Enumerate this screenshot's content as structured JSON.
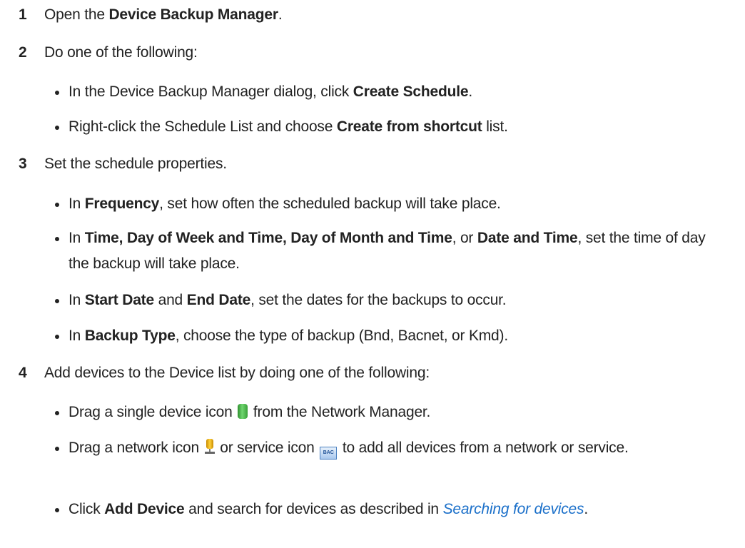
{
  "steps": [
    {
      "num": "1",
      "pre": "Open the ",
      "bold": "Device Backup Manager",
      "post": "."
    },
    {
      "num": "2",
      "text": "Do one of the following:",
      "bullets": [
        {
          "pre": "In the Device Backup Manager dialog, click ",
          "bold": "Create Schedule",
          "post": "."
        },
        {
          "pre": "Right-click the Schedule List and choose ",
          "bold": "Create from shortcut",
          "post": " list."
        }
      ]
    },
    {
      "num": "3",
      "text": "Set the schedule properties.",
      "bullets": [
        {
          "pre": "In ",
          "bold": "Frequency",
          "post": ", set how often the scheduled backup will take place."
        },
        {
          "pre": "In ",
          "bold1": "Time, Day of Week and Time, Day of Month and Time",
          "mid": ", or ",
          "bold2": "Date and Time",
          "post": ", set the time of day the backup will take place."
        },
        {
          "pre": "In ",
          "bold1": "Start Date",
          "mid": " and ",
          "bold2": "End Date",
          "post": ", set the dates for the backups to occur."
        },
        {
          "pre": "In ",
          "bold": "Backup Type",
          "post": ", choose the type of backup (Bnd, Bacnet, or Kmd)."
        }
      ]
    },
    {
      "num": "4",
      "text": "Add devices to the Device list by doing one of the following:",
      "bullets": [
        {
          "pre": "Drag a single device icon",
          "icon": "device-icon",
          "post": "from the Network Manager."
        },
        {
          "pre": "Drag a network icon",
          "icon1": "network-icon",
          "mid": "or service icon",
          "icon2": "service-icon",
          "icon2_label": "BAC",
          "post": "to add all devices from a network or service."
        },
        {
          "pre": "Click ",
          "bold": "Add Device",
          "mid": " and search for devices as described in ",
          "link": "Searching for devices",
          "post": "."
        }
      ]
    }
  ]
}
